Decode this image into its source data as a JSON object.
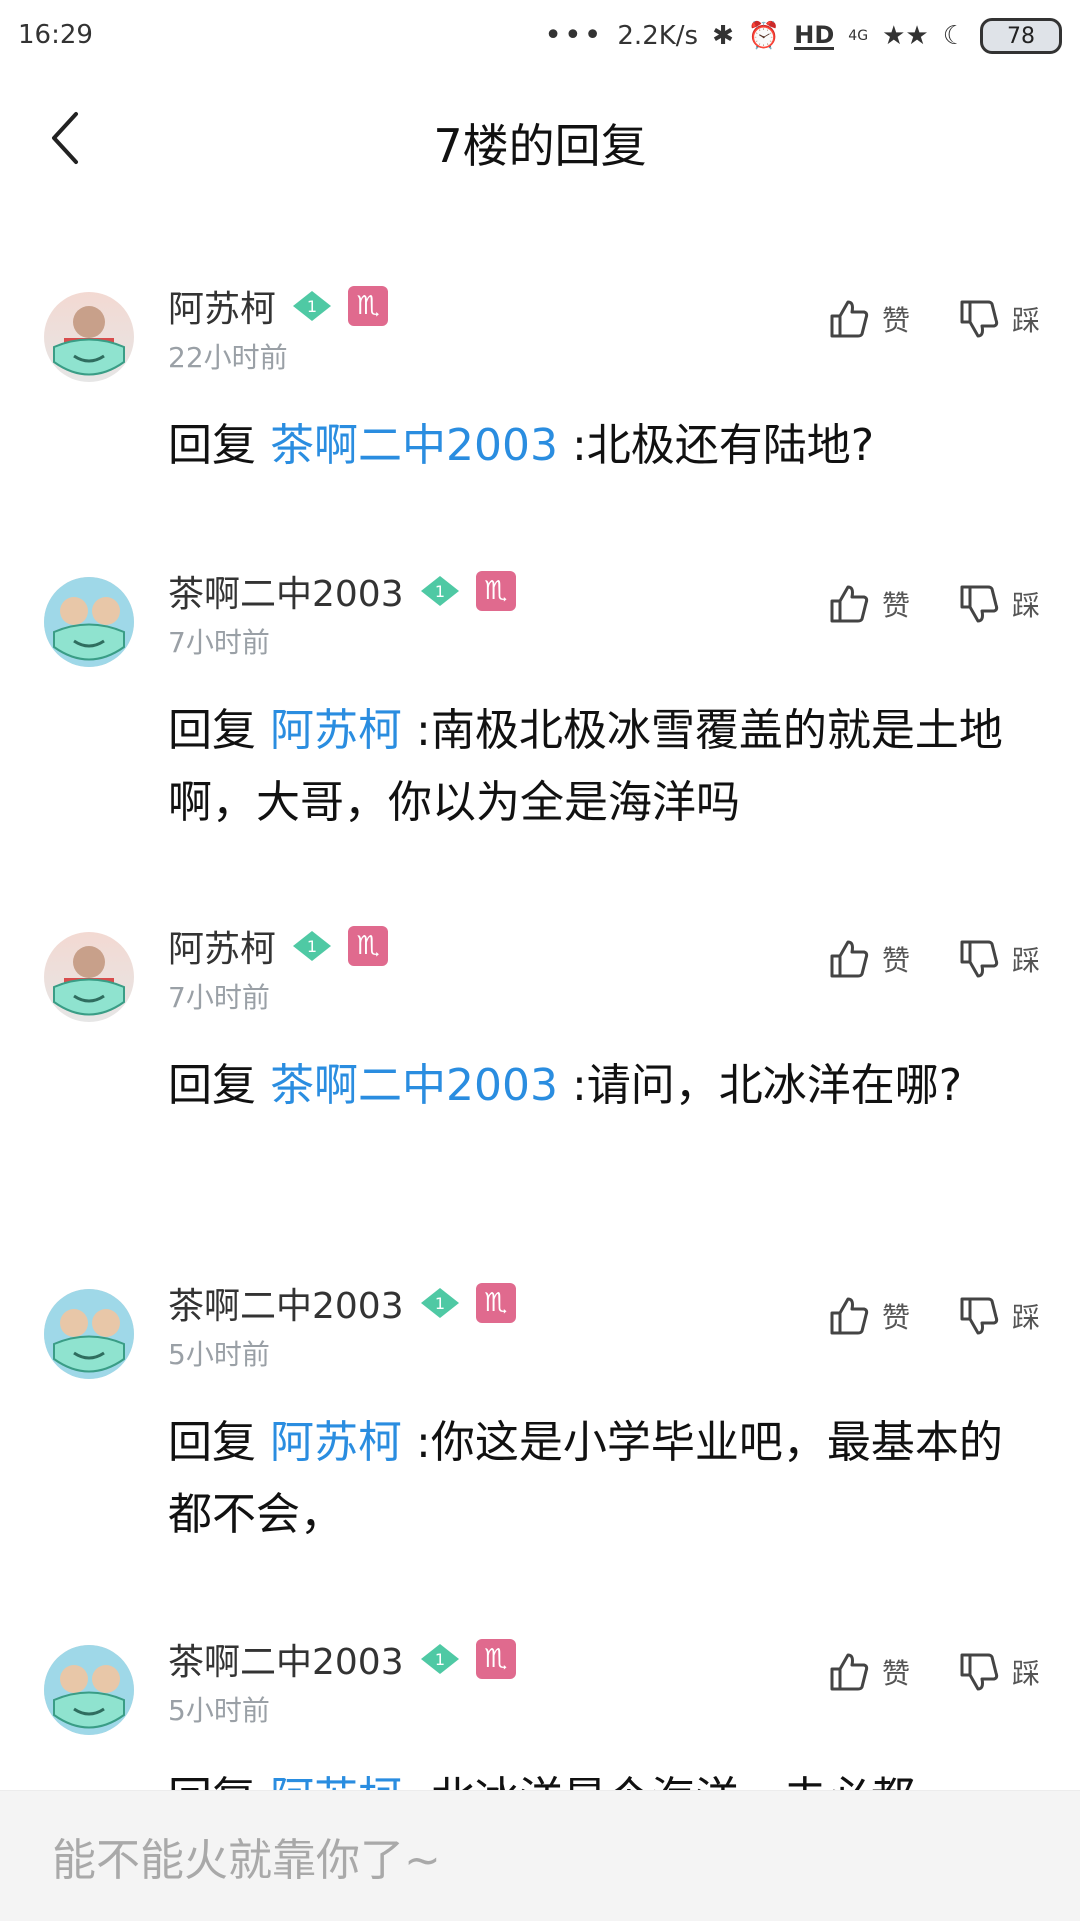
{
  "status_bar": {
    "time": "16:29",
    "net_speed": "2.2K/s",
    "network": "4G",
    "hd": "HD",
    "battery": "78"
  },
  "header": {
    "title": "7楼的回复"
  },
  "replies": [
    {
      "username": "阿苏柯",
      "level": "1",
      "zodiac": "♏",
      "time": "22小时前",
      "like_label": "赞",
      "dislike_label": "踩",
      "reply_prefix": "回复",
      "mention": "茶啊二中2003",
      "text": ":北极还有陆地?"
    },
    {
      "username": "茶啊二中2003",
      "level": "1",
      "zodiac": "♏",
      "time": "7小时前",
      "like_label": "赞",
      "dislike_label": "踩",
      "reply_prefix": "回复",
      "mention": "阿苏柯",
      "text": ":南极北极冰雪覆盖的就是土地啊，大哥，你以为全是海洋吗"
    },
    {
      "username": "阿苏柯",
      "level": "1",
      "zodiac": "♏",
      "time": "7小时前",
      "like_label": "赞",
      "dislike_label": "踩",
      "reply_prefix": "回复",
      "mention": "茶啊二中2003",
      "text": ":请问，北冰洋在哪?"
    },
    {
      "username": "茶啊二中2003",
      "level": "1",
      "zodiac": "♏",
      "time": "5小时前",
      "like_label": "赞",
      "dislike_label": "踩",
      "reply_prefix": "回复",
      "mention": "阿苏柯",
      "text": ":你这是小学毕业吧，最基本的都不会，"
    },
    {
      "username": "茶啊二中2003",
      "level": "1",
      "zodiac": "♏",
      "time": "5小时前",
      "like_label": "赞",
      "dislike_label": "踩",
      "reply_prefix": "回复",
      "mention": "阿苏柯",
      "text": ":北冰洋是个海洋，未必都"
    }
  ],
  "composer": {
    "placeholder": "能不能火就靠你了~"
  },
  "colors": {
    "mention": "#2a8de0",
    "level_badge": "#4fc9a4",
    "zodiac_badge": "#e06a8e"
  }
}
